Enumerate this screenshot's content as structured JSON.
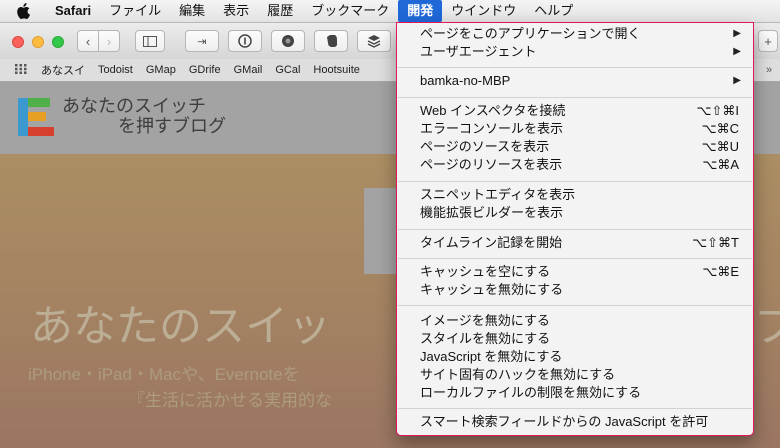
{
  "menubar": {
    "app_name": "Safari",
    "items": [
      "ファイル",
      "編集",
      "表示",
      "履歴",
      "ブックマーク",
      "開発",
      "ウインドウ",
      "ヘルプ"
    ],
    "active_item": "開発",
    "active_color": "#1f68d8"
  },
  "bookmarks": [
    "あなスイ",
    "Todoist",
    "GMap",
    "GDrife",
    "GMail",
    "GCal",
    "Hootsuite"
  ],
  "site": {
    "title_line1": "あなたのスイッチ",
    "title_line2": "を押すブログ",
    "hero_title": "あなたのスイッ",
    "hero_title_tail": "ブ",
    "hero_sub1": "iPhone・iPad・Macや、Evernoteを",
    "hero_sub2": "『生活に活かせる実用的な"
  },
  "dropdown": {
    "border_color": "#e0185a",
    "items": [
      {
        "label": "ページをこのアプリケーションで開く",
        "submenu": true
      },
      {
        "label": "ユーザエージェント",
        "submenu": true
      },
      {
        "label": "bamka-no-MBP",
        "submenu": true
      },
      {
        "label": "Web インスペクタを接続",
        "shortcut": "⌥⇧⌘I"
      },
      {
        "label": "エラーコンソールを表示",
        "shortcut": "⌥⌘C"
      },
      {
        "label": "ページのソースを表示",
        "shortcut": "⌥⌘U"
      },
      {
        "label": "ページのリソースを表示",
        "shortcut": "⌥⌘A"
      },
      {
        "label": "スニペットエディタを表示"
      },
      {
        "label": "機能拡張ビルダーを表示"
      },
      {
        "label": "タイムライン記録を開始",
        "shortcut": "⌥⇧⌘T"
      },
      {
        "label": "キャッシュを空にする",
        "shortcut": "⌥⌘E"
      },
      {
        "label": "キャッシュを無効にする"
      },
      {
        "label": "イメージを無効にする"
      },
      {
        "label": "スタイルを無効にする"
      },
      {
        "label": "JavaScript を無効にする"
      },
      {
        "label": "サイト固有のハックを無効にする"
      },
      {
        "label": "ローカルファイルの制限を無効にする"
      },
      {
        "label": "スマート検索フィールドからの JavaScript を許可"
      }
    ]
  }
}
